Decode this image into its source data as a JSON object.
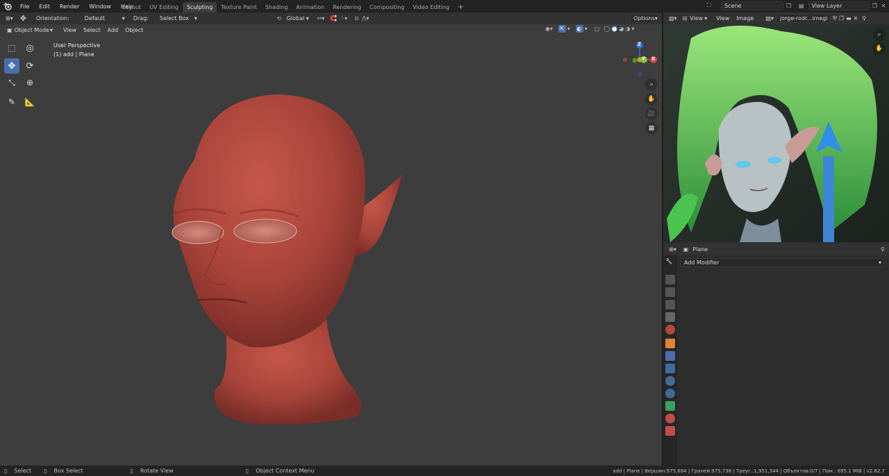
{
  "top_menu": [
    "File",
    "Edit",
    "Render",
    "Window",
    "Help"
  ],
  "workspaces": [
    "Layout",
    "UV Editing",
    "Sculpting",
    "Texture Paint",
    "Shading",
    "Animation",
    "Rendering",
    "Compositing",
    "Video Editing"
  ],
  "active_workspace": "Sculpting",
  "add_workspace": "+",
  "scene": "Scene",
  "view_layer": "View Layer",
  "tool_header": {
    "orientation_label": "Orientation:",
    "orientation_value": "Default",
    "drag_label": "Drag:",
    "drag_value": "Select Box",
    "transform_orientation": "Global",
    "options_label": "Options"
  },
  "viewport_header": {
    "mode": "Object Mode",
    "view": "View",
    "select": "Select",
    "add": "Add",
    "object": "Object"
  },
  "viewport_overlay": {
    "perspective": "User Perspective",
    "object_info": "(1) add | Plane"
  },
  "gizmo_axes": {
    "x": "X",
    "y": "Y",
    "z": "Z"
  },
  "image_editor": {
    "view": "View",
    "view2": "View",
    "image": "Image",
    "image_name": "jorge-rodr...imegirl.jpg"
  },
  "properties": {
    "object_name": "Plane",
    "add_modifier": "Add Modifier"
  },
  "status_bar": {
    "select": "Select",
    "box_select": "Box Select",
    "rotate_view": "Rotate View",
    "context_menu": "Object Context Menu",
    "stats": "add | Plane | Вершин:975,694 | Граней:975,736 | Треуг.:1,951,344 | Объектов:0/7 | Пам.: 695.1 MiB | v2.82.7"
  },
  "colors": {
    "accent_blue": "#4a6fae",
    "viewport_bg": "#3d3d3d",
    "head_red": "#b34a3e",
    "hair_green": "#3fbf4a"
  }
}
